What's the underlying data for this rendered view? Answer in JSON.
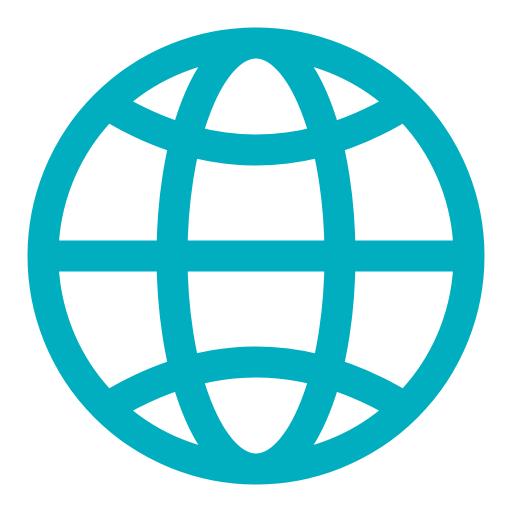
{
  "icon": {
    "name": "globe-icon",
    "color": "#00AEC0",
    "background": "#FFFFFF"
  }
}
